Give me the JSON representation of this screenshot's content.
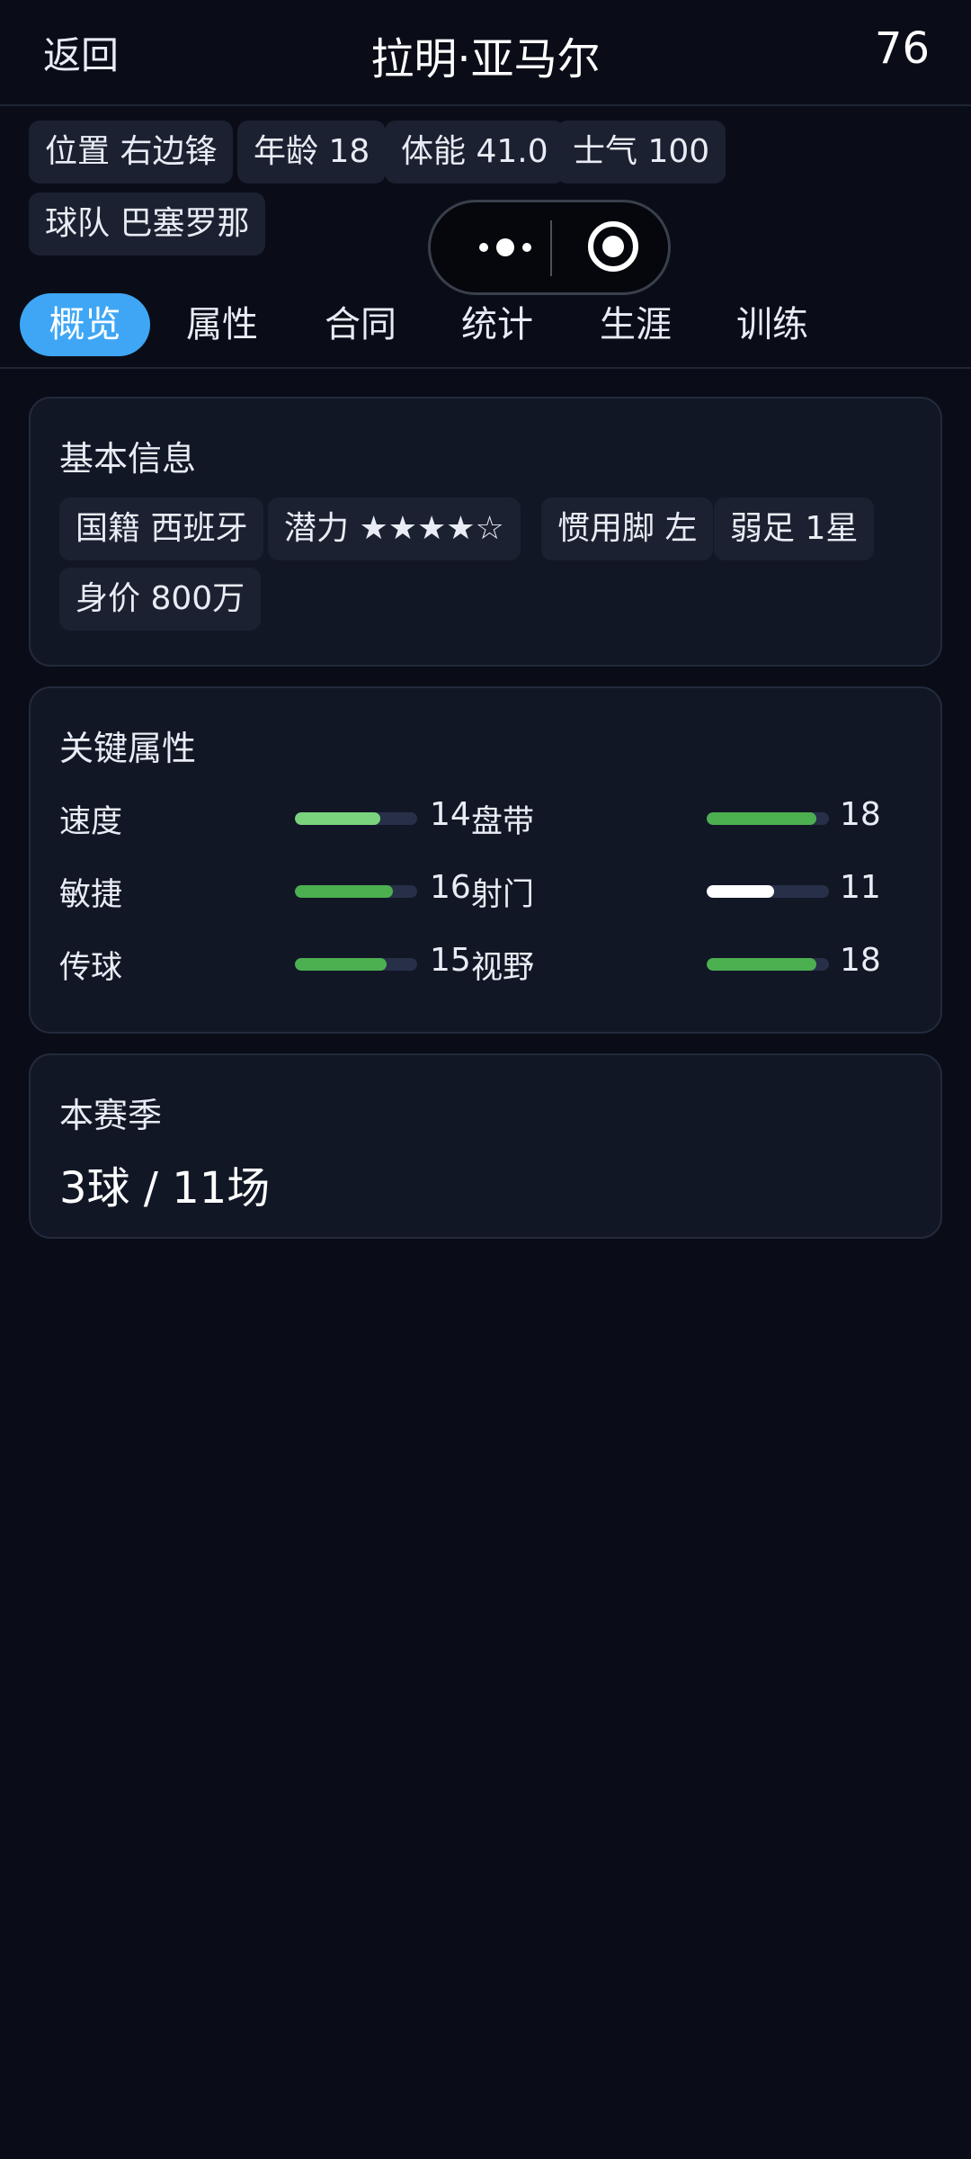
{
  "header": {
    "back": "返回",
    "player_name": "拉明·亚马尔",
    "overall": "76"
  },
  "info_chips": [
    "位置 右边锋",
    "年龄 18",
    "体能 41.0",
    "士气 100",
    "球队 巴塞罗那"
  ],
  "capsule": {
    "menu_icon": "more-dots-icon",
    "close_icon": "target-circle-icon"
  },
  "tabs": [
    "概览",
    "属性",
    "合同",
    "统计",
    "生涯",
    "训练"
  ],
  "active_tab": "概览",
  "basic_info": {
    "title": "基本信息",
    "chips": [
      "国籍 西班牙",
      "潜力 ★★★★☆",
      "惯用脚 左",
      "弱足 1星",
      "身价 800万"
    ]
  },
  "key_attributes": {
    "title": "关键属性",
    "max": 20,
    "rows": [
      {
        "left": {
          "name": "速度",
          "value": "14",
          "level": 14,
          "color": "#7ad47e"
        },
        "right": {
          "name": "盘带",
          "value": "18",
          "level": 18,
          "color": "#4caf50"
        }
      },
      {
        "left": {
          "name": "敏捷",
          "value": "16",
          "level": 16,
          "color": "#4caf50"
        },
        "right": {
          "name": "射门",
          "value": "11",
          "level": 11,
          "color": "#ffffff"
        }
      },
      {
        "left": {
          "name": "传球",
          "value": "15",
          "level": 15,
          "color": "#4caf50"
        },
        "right": {
          "name": "视野",
          "value": "18",
          "level": 18,
          "color": "#4caf50"
        }
      }
    ]
  },
  "season": {
    "title": "本赛季",
    "summary": "3球 / 11场"
  },
  "colors": {
    "background": "#0a0d17",
    "card": "#121726",
    "chip": "#1b2131",
    "accent": "#3ea6f5",
    "track": "#273048"
  }
}
